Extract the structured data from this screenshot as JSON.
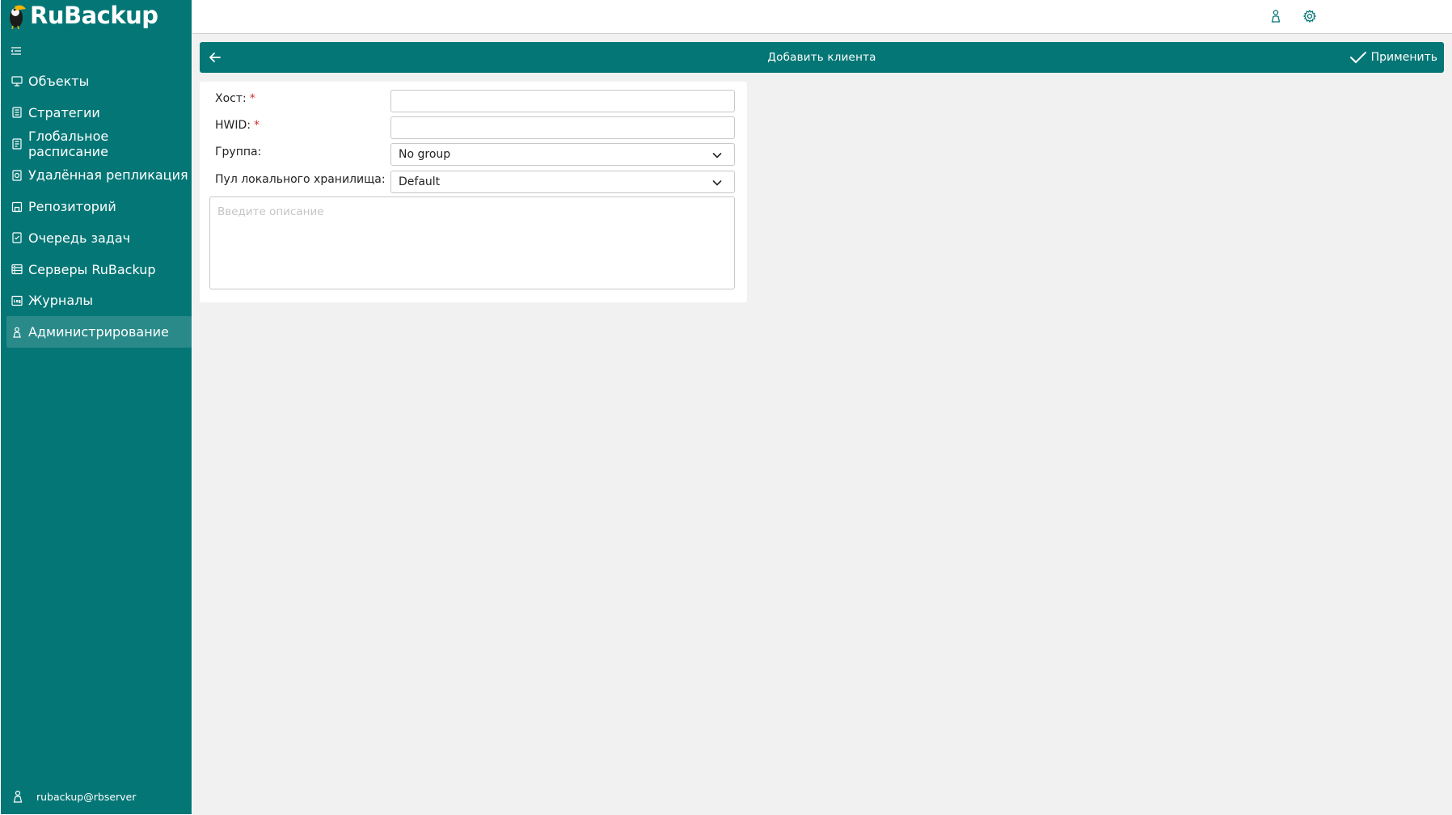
{
  "app": {
    "logo_prefix": "Ru",
    "logo_suffix": "Backup"
  },
  "sidebar": {
    "items": [
      {
        "label": "Объекты",
        "icon": "monitor-icon"
      },
      {
        "label": "Стратегии",
        "icon": "document-icon"
      },
      {
        "label": "Глобальное расписание",
        "icon": "schedule-icon"
      },
      {
        "label": "Удалённая репликация",
        "icon": "replication-icon"
      },
      {
        "label": "Репозиторий",
        "icon": "repository-icon"
      },
      {
        "label": "Очередь задач",
        "icon": "task-queue-icon"
      },
      {
        "label": "Серверы RuBackup",
        "icon": "server-icon"
      },
      {
        "label": "Журналы",
        "icon": "log-icon"
      },
      {
        "label": "Администрирование",
        "icon": "admin-icon"
      }
    ],
    "active_index": 8,
    "user": "rubackup@rbserver"
  },
  "header": {
    "title": "Добавить клиента",
    "apply_label": "Применить"
  },
  "form": {
    "host": {
      "label": "Хост:",
      "required_mark": "*",
      "value": ""
    },
    "hwid": {
      "label": "HWID:",
      "required_mark": "*",
      "value": ""
    },
    "group": {
      "label": "Группа:",
      "value": "No group"
    },
    "pool": {
      "label": "Пул локального хранилища:",
      "value": "Default"
    },
    "description": {
      "placeholder": "Введите описание"
    }
  },
  "colors": {
    "accent": "#057676",
    "background": "#f1f1f1",
    "required": "#d0312d"
  }
}
